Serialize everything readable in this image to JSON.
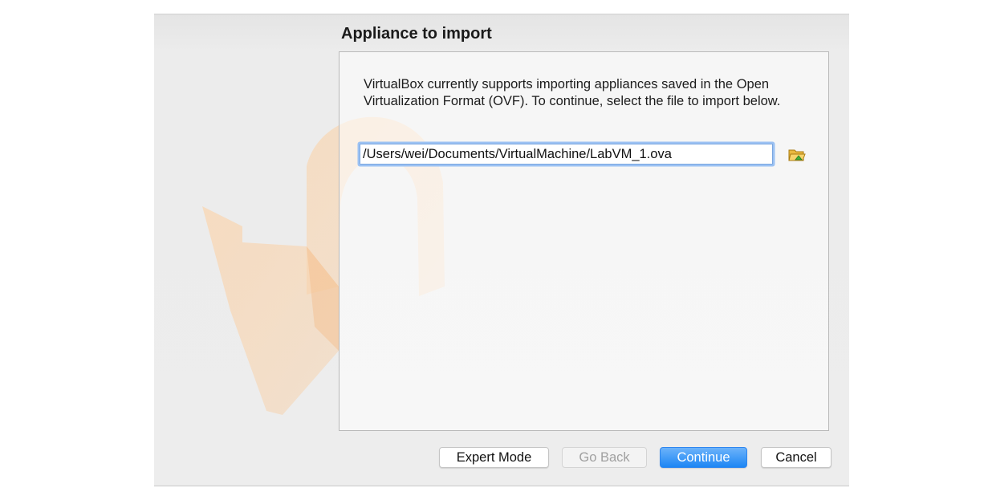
{
  "wizard": {
    "page_title": "Appliance to import",
    "description": "VirtualBox currently supports importing appliances saved in the Open Virtualization Format (OVF). To continue, select the file to import below.",
    "file_path": "/Users/wei/Documents/VirtualMachine/LabVM_1.ova",
    "browse_icon": "folder-open-icon"
  },
  "buttons": {
    "expert_mode": "Expert Mode",
    "go_back": "Go Back",
    "continue": "Continue",
    "cancel": "Cancel"
  },
  "colors": {
    "primary_button": "#1d86f4",
    "watermark": "#f6c89a",
    "input_focus_ring": "#9cc2f3"
  }
}
